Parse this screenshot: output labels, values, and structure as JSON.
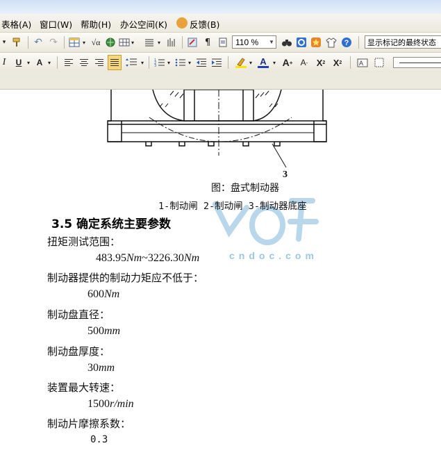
{
  "menu": {
    "items": [
      {
        "label": "表格(A)"
      },
      {
        "label": "窗口(W)"
      },
      {
        "label": "帮助(H)"
      },
      {
        "label": "办公空间(K)"
      },
      {
        "label": "反馈(B)"
      }
    ]
  },
  "toolbar": {
    "zoom_value": "110 %",
    "markup_view": "显示标记的最终状态"
  },
  "figure": {
    "part_label": "3",
    "caption": "图：盘式制动器",
    "legend": "1-制动闸 2-制动闸 3-制动器底座"
  },
  "section": {
    "heading": "3.5  确定系统主要参数"
  },
  "params": [
    {
      "label": "扭矩测试范围：",
      "value_num": "483.95",
      "value_unit": "Nm",
      "value_sep": "~",
      "value_num2": "3226.30",
      "value_unit2": "Nm"
    },
    {
      "label": "制动器提供的制动力矩应不低于：",
      "value_num": "600",
      "value_unit": "Nm"
    },
    {
      "label": "制动盘直径：",
      "value_num": "500",
      "value_unit": "mm"
    },
    {
      "label": "制动盘厚度：",
      "value_num": "30",
      "value_unit": "mm"
    },
    {
      "label": "装置最大转速：",
      "value_num": "1500",
      "value_unit": "r/min"
    },
    {
      "label": "制动片摩擦系数：",
      "value_num": "0.3",
      "value_unit": ""
    }
  ],
  "watermark": {
    "text": "cndoc.com"
  }
}
